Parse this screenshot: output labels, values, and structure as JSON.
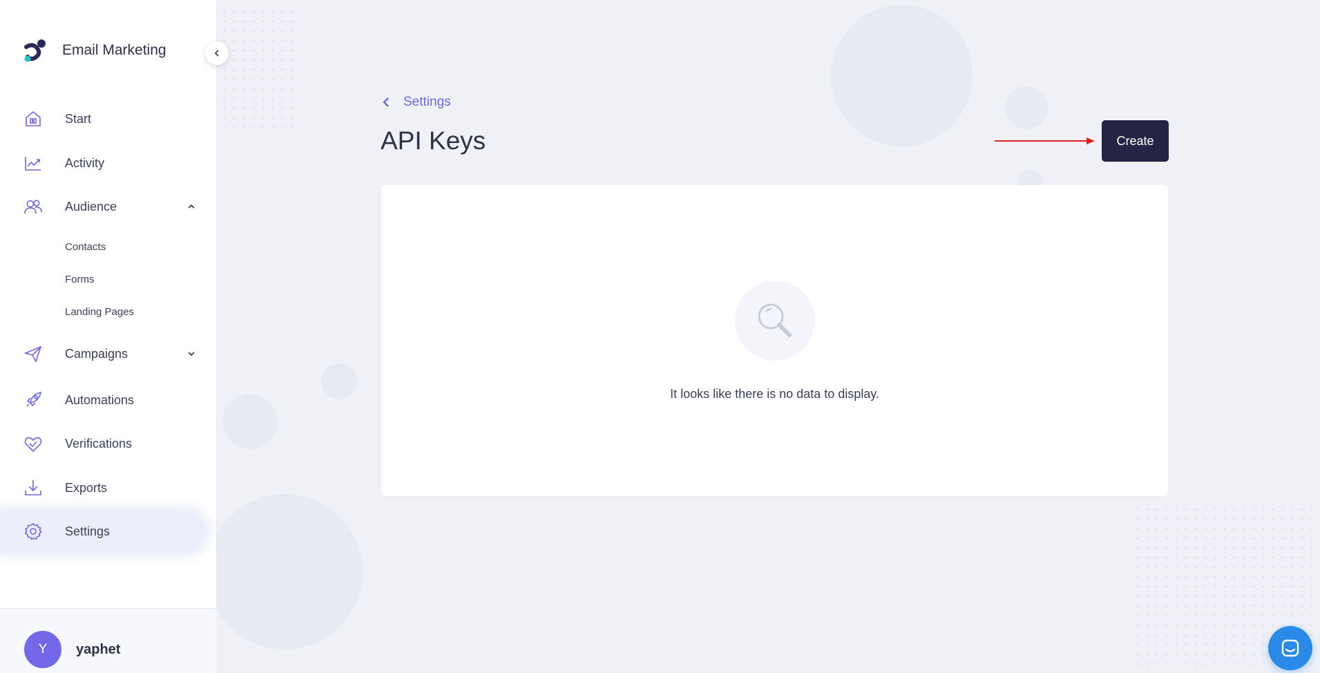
{
  "sidebar": {
    "brand_title": "Email Marketing",
    "items": [
      {
        "label": "Start",
        "icon": "home-icon"
      },
      {
        "label": "Activity",
        "icon": "chart-line-icon"
      },
      {
        "label": "Audience",
        "icon": "users-icon",
        "expanded": true,
        "children": [
          {
            "label": "Contacts"
          },
          {
            "label": "Forms"
          },
          {
            "label": "Landing Pages"
          }
        ]
      },
      {
        "label": "Campaigns",
        "icon": "paper-plane-icon",
        "expanded": false
      },
      {
        "label": "Automations",
        "icon": "rocket-icon"
      },
      {
        "label": "Verifications",
        "icon": "heart-check-icon"
      },
      {
        "label": "Exports",
        "icon": "download-icon"
      },
      {
        "label": "Settings",
        "icon": "gear-icon",
        "active": true
      }
    ],
    "user": {
      "initial": "Y",
      "name": "yaphet"
    }
  },
  "main": {
    "breadcrumb": "Settings",
    "title": "API Keys",
    "create_label": "Create",
    "empty_message": "It looks like there is no data to display."
  },
  "colors": {
    "accent": "#6b66d8",
    "button_dark": "#252444",
    "avatar": "#7369e8",
    "chat": "#2b8ae8",
    "annotation_arrow": "#e02020"
  }
}
